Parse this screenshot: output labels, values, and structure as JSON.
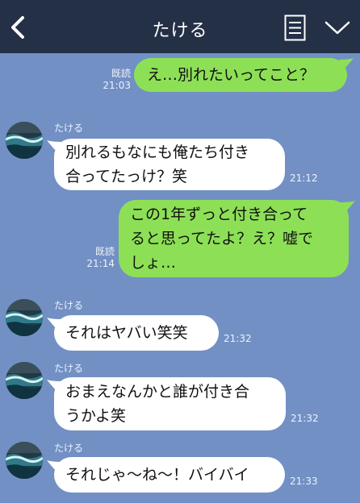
{
  "header": {
    "title": "たける"
  },
  "messages": [
    {
      "from": "me",
      "text": "え…別れたいってこと？",
      "read": "既読",
      "time": "21:03"
    },
    {
      "from": "partner",
      "sender": "たける",
      "text": "別れるもなにも俺たち付き合ってたっけ？笑",
      "lines": [
        "別れるもなにも俺たち付き",
        "合ってたっけ？笑"
      ],
      "time": "21:12"
    },
    {
      "from": "me",
      "text": "この1年ずっと付き合ってると思ってたよ？え？嘘でしょ…",
      "lines": [
        "この1年ずっと付き合って",
        "ると思ってたよ？え？嘘で",
        "しょ…"
      ],
      "read": "既読",
      "time": "21:14"
    },
    {
      "from": "partner",
      "sender": "たける",
      "text": "それはヤバい笑笑",
      "time": "21:32"
    },
    {
      "from": "partner",
      "sender": "たける",
      "text": "おまえなんかと誰が付き合うかよ笑",
      "lines": [
        "おまえなんかと誰が付き合",
        "うかよ笑"
      ],
      "time": "21:32"
    },
    {
      "from": "partner",
      "sender": "たける",
      "text": "それじゃ〜ね〜！バイバイ",
      "time": "21:33"
    }
  ],
  "colors": {
    "header_bg": "#233046",
    "chat_bg": "#7290c4",
    "outgoing_bubble": "#8de056",
    "incoming_bubble": "#ffffff"
  },
  "icons": [
    "back-chevron-icon",
    "menu-document-icon",
    "chevron-down-icon",
    "avatar-ocean-wave"
  ]
}
